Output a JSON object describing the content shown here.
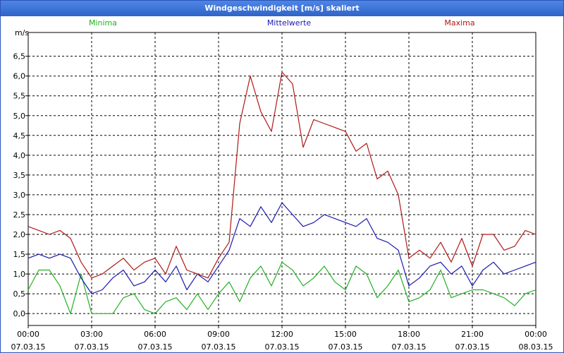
{
  "window": {
    "title": "Windgeschwindigkeit [m/s] skaliert"
  },
  "chart_data": {
    "type": "line",
    "ylabel": "m/s",
    "ylim": [
      -0.3,
      7.1
    ],
    "yticks": [
      "0,0",
      "0,5",
      "1,0",
      "1,5",
      "2,0",
      "2,5",
      "3,0",
      "3,5",
      "4,0",
      "4,5",
      "5,0",
      "5,5",
      "6,0",
      "6,5"
    ],
    "ytick_values": [
      0,
      0.5,
      1,
      1.5,
      2,
      2.5,
      3,
      3.5,
      4,
      4.5,
      5,
      5.5,
      6,
      6.5
    ],
    "xlim": [
      0,
      24
    ],
    "xticks": [
      {
        "x": 0,
        "time": "00:00",
        "date": "07.03.15"
      },
      {
        "x": 3,
        "time": "03:00",
        "date": "07.03.15"
      },
      {
        "x": 6,
        "time": "06:00",
        "date": "07.03.15"
      },
      {
        "x": 9,
        "time": "09:00",
        "date": "07.03.15"
      },
      {
        "x": 12,
        "time": "12:00",
        "date": "07.03.15"
      },
      {
        "x": 15,
        "time": "15:00",
        "date": "07.03.15"
      },
      {
        "x": 18,
        "time": "18:00",
        "date": "07.03.15"
      },
      {
        "x": 21,
        "time": "21:00",
        "date": "07.03.15"
      },
      {
        "x": 24,
        "time": "00:00",
        "date": "08.03.15"
      }
    ],
    "grid": true,
    "legend_position": "top",
    "series": [
      {
        "name": "Minima",
        "color": "#22b022",
        "x": [
          0,
          0.5,
          1,
          1.5,
          2,
          2.5,
          3,
          3.5,
          4,
          4.5,
          5,
          5.5,
          6,
          6.5,
          7,
          7.5,
          8,
          8.5,
          9,
          9.5,
          10,
          10.5,
          11,
          11.5,
          12,
          12.5,
          13,
          13.5,
          14,
          14.5,
          15,
          15.5,
          16,
          16.5,
          17,
          17.5,
          18,
          18.5,
          19,
          19.5,
          20,
          20.5,
          21,
          21.5,
          22,
          22.5,
          23,
          23.5,
          24
        ],
        "values": [
          0.6,
          1.1,
          1.1,
          0.7,
          0.0,
          1.0,
          0.0,
          0.0,
          0.0,
          0.4,
          0.5,
          0.1,
          0.0,
          0.3,
          0.4,
          0.1,
          0.5,
          0.1,
          0.5,
          0.8,
          0.3,
          0.9,
          1.2,
          0.7,
          1.3,
          1.1,
          0.7,
          0.9,
          1.2,
          0.8,
          0.6,
          1.2,
          1.0,
          0.4,
          0.7,
          1.1,
          0.3,
          0.4,
          0.6,
          1.1,
          0.4,
          0.5,
          0.6,
          0.6,
          0.5,
          0.4,
          0.2,
          0.5,
          0.6
        ]
      },
      {
        "name": "Mittelwerte",
        "color": "#1a1ab0",
        "x": [
          0,
          0.5,
          1,
          1.5,
          2,
          2.5,
          3,
          3.5,
          4,
          4.5,
          5,
          5.5,
          6,
          6.5,
          7,
          7.5,
          8,
          8.5,
          9,
          9.5,
          10,
          10.5,
          11,
          11.5,
          12,
          12.5,
          13,
          13.5,
          14,
          14.5,
          15,
          15.5,
          16,
          16.5,
          17,
          17.5,
          18,
          18.5,
          19,
          19.5,
          20,
          20.5,
          21,
          21.5,
          22,
          22.5,
          23,
          23.5,
          24
        ],
        "values": [
          1.4,
          1.5,
          1.4,
          1.5,
          1.4,
          0.9,
          0.5,
          0.6,
          0.9,
          1.1,
          0.7,
          0.8,
          1.1,
          0.8,
          1.2,
          0.6,
          1.0,
          0.8,
          1.2,
          1.6,
          2.4,
          2.2,
          2.7,
          2.3,
          2.8,
          2.5,
          2.2,
          2.3,
          2.5,
          2.4,
          2.3,
          2.2,
          2.4,
          1.9,
          1.8,
          1.6,
          0.7,
          0.9,
          1.2,
          1.3,
          1.0,
          1.2,
          0.7,
          1.1,
          1.3,
          1.0,
          1.1,
          1.2,
          1.3
        ]
      },
      {
        "name": "Maxima",
        "color": "#b01818",
        "x": [
          0,
          0.5,
          1,
          1.5,
          2,
          2.5,
          3,
          3.5,
          4,
          4.5,
          5,
          5.5,
          6,
          6.5,
          7,
          7.5,
          8,
          8.5,
          9,
          9.5,
          10,
          10.5,
          11,
          11.5,
          12,
          12.5,
          13,
          13.5,
          14,
          14.5,
          15,
          15.5,
          16,
          16.5,
          17,
          17.5,
          18,
          18.5,
          19,
          19.5,
          20,
          20.5,
          21,
          21.5,
          22,
          22.5,
          23,
          23.5,
          24
        ],
        "values": [
          2.2,
          2.1,
          2.0,
          2.1,
          1.9,
          1.3,
          0.9,
          1.0,
          1.2,
          1.4,
          1.1,
          1.3,
          1.4,
          1.0,
          1.7,
          1.1,
          1.0,
          0.9,
          1.4,
          1.8,
          4.8,
          6.0,
          5.1,
          4.6,
          6.1,
          5.8,
          4.2,
          4.9,
          4.8,
          4.7,
          4.6,
          4.1,
          4.3,
          3.4,
          3.6,
          3.0,
          1.4,
          1.6,
          1.4,
          1.8,
          1.3,
          1.9,
          1.2,
          2.0,
          2.0,
          1.6,
          1.7,
          2.1,
          2.0
        ]
      }
    ]
  }
}
